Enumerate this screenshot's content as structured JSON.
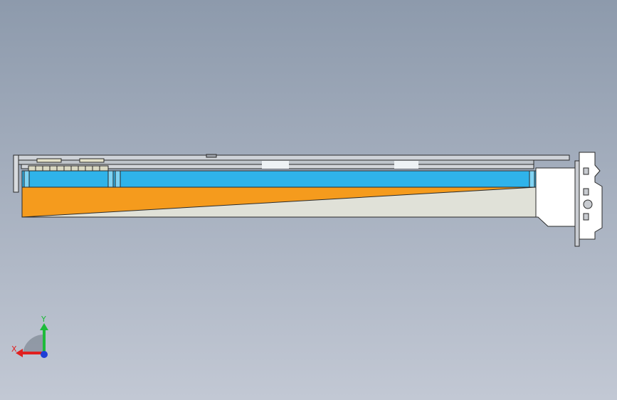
{
  "viewport": {
    "background_top": "#8d9aac",
    "background_bottom": "#c2c8d4"
  },
  "model": {
    "colors": {
      "outline": "#2a2a2a",
      "board": "#c8ccd2",
      "shroud_fill": "#2fb3ea",
      "shroud_edge": "#12a0dd",
      "heatsink_wedge": "#f59b1d",
      "base_plate": "#e0e1d8",
      "bracket": "#ffffff",
      "bracket_shadow": "#b9bcc2",
      "highlight": "#eef2f5"
    }
  },
  "triad": {
    "x_label": "X",
    "y_label": "Y",
    "x_color": "#e02020",
    "y_color": "#1dbb3a",
    "z_color": "#1f3fd6"
  }
}
